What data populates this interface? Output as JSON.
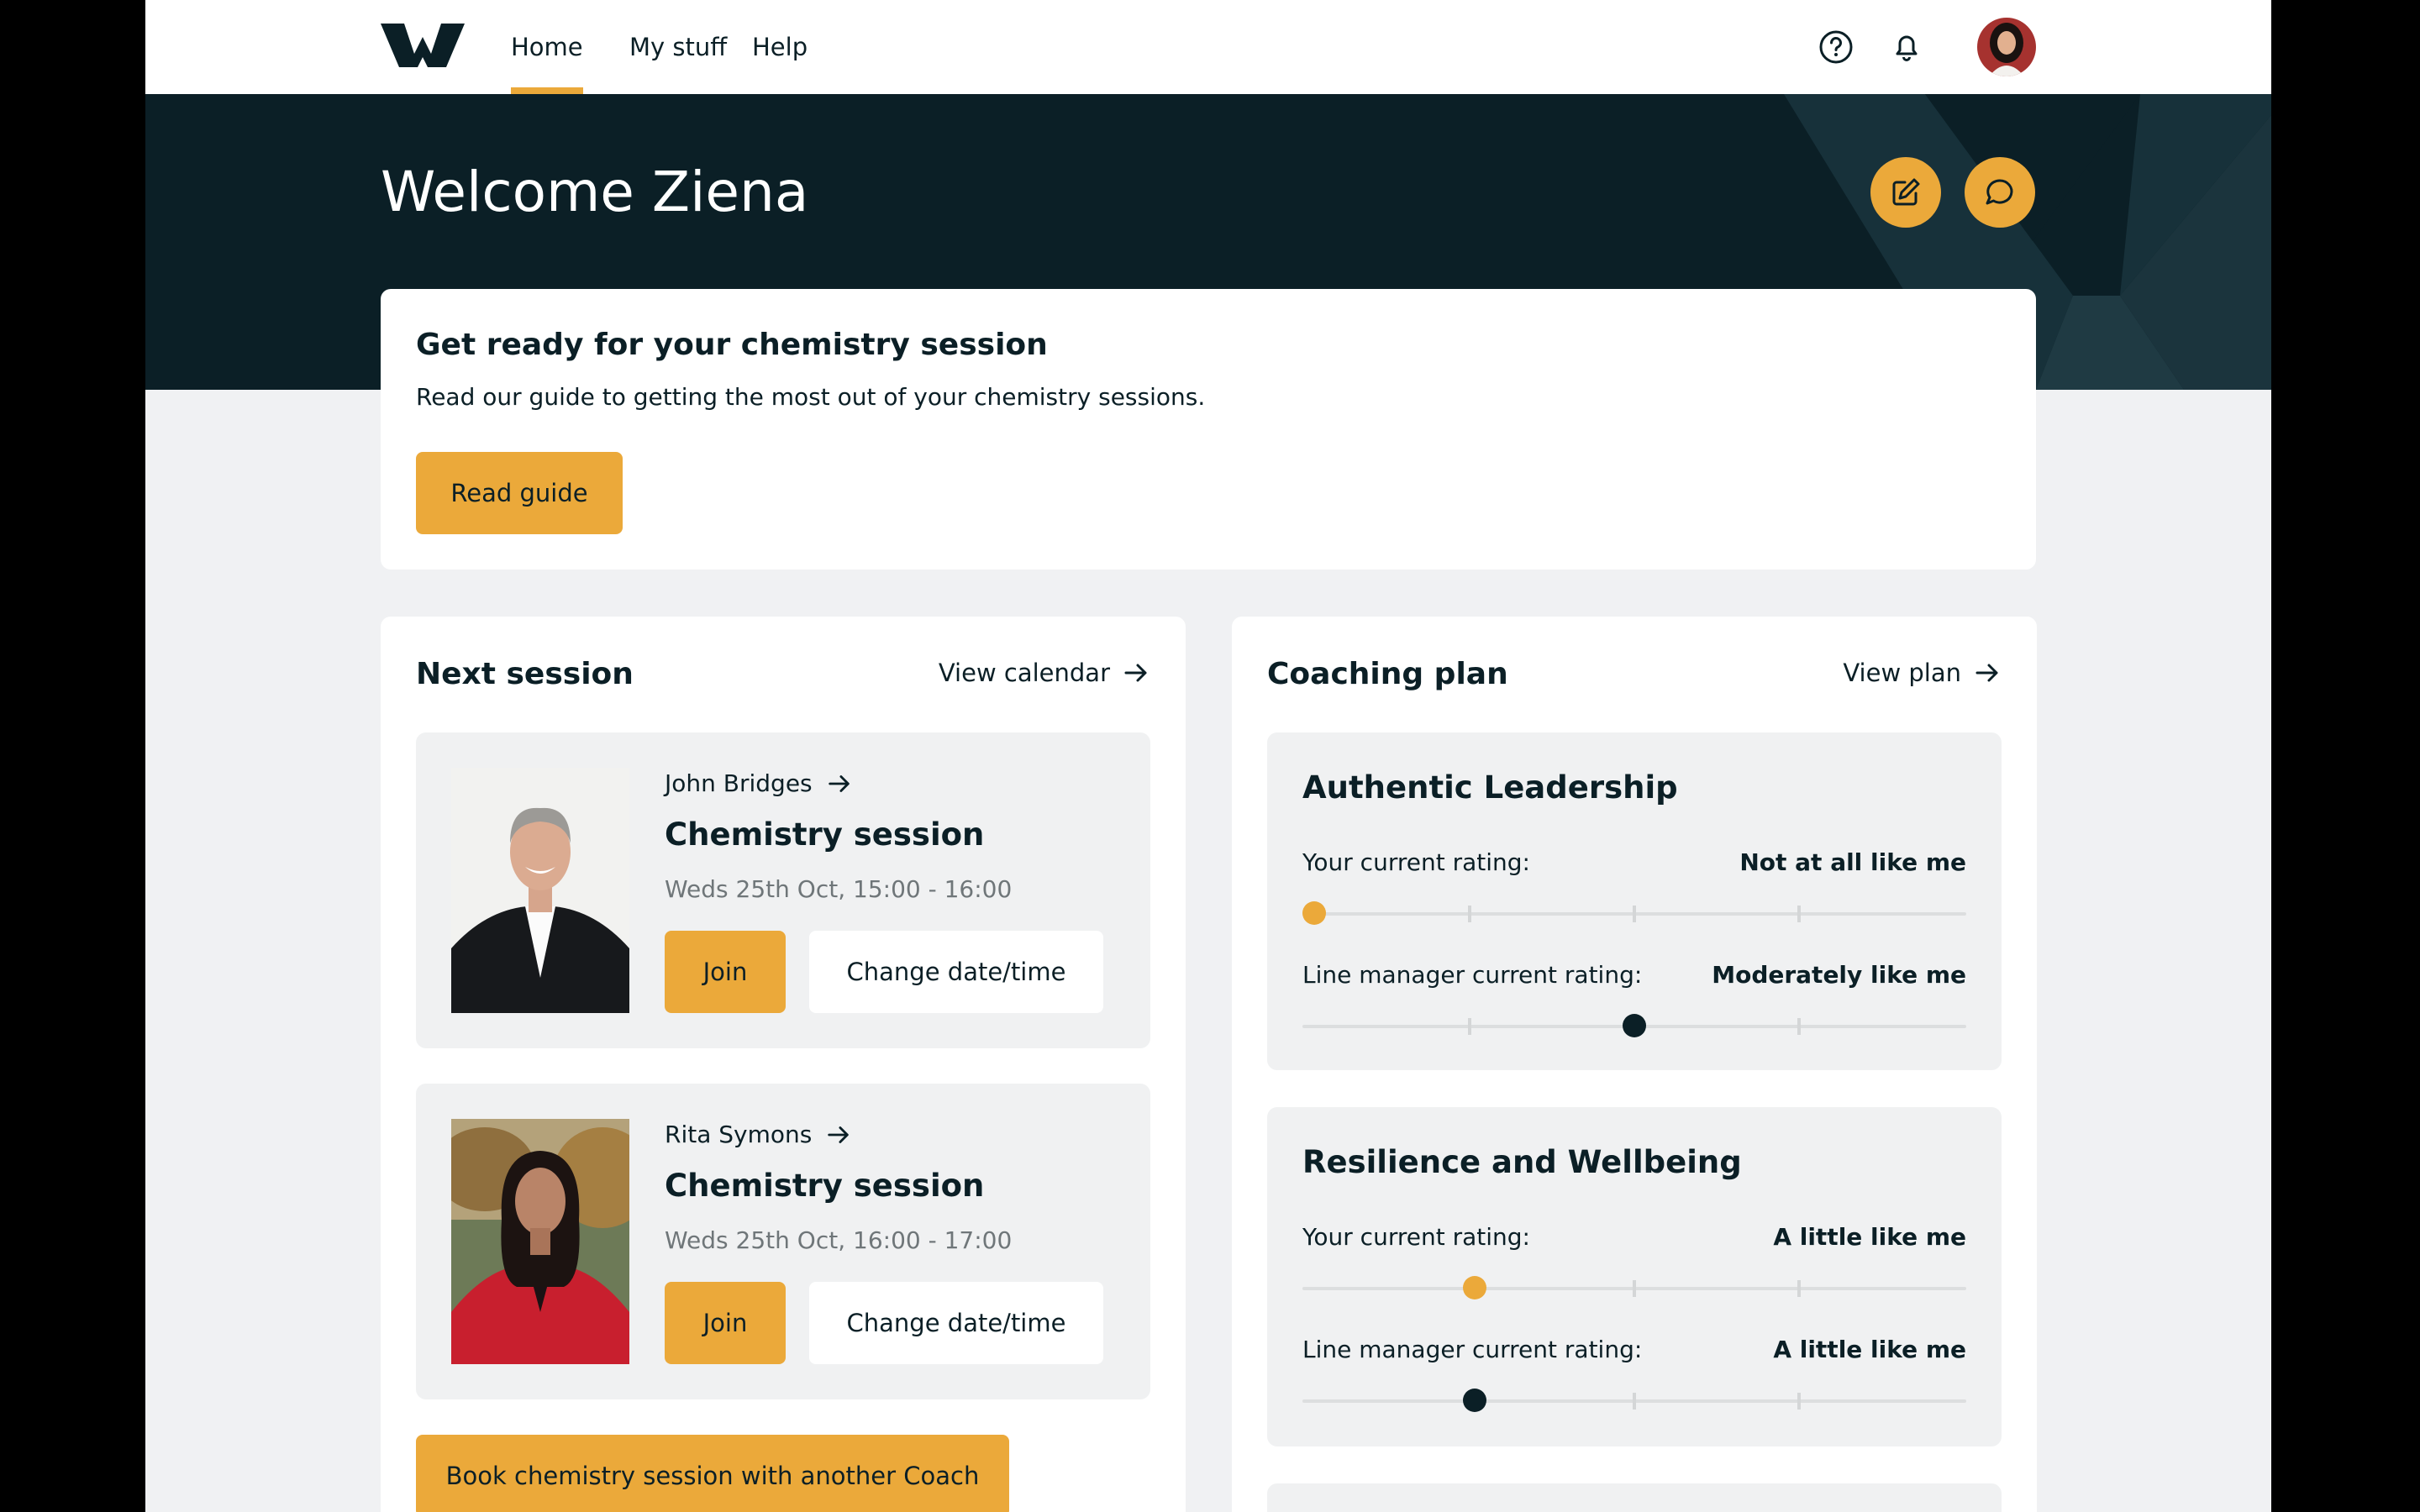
{
  "nav": {
    "tabs": [
      {
        "label": "Home",
        "active": true
      },
      {
        "label": "My stuff",
        "active": false
      },
      {
        "label": "Help",
        "active": false
      }
    ],
    "icons": [
      "help-circle-icon",
      "bell-icon"
    ]
  },
  "hero": {
    "welcome": "Welcome Ziena"
  },
  "guide": {
    "title": "Get ready for your chemistry session",
    "description": "Read our guide to getting the most out of your chemistry sessions.",
    "button": "Read guide"
  },
  "sessions": {
    "heading": "Next session",
    "link": "View calendar",
    "items": [
      {
        "coach": "John Bridges",
        "title": "Chemistry session",
        "time": "Weds 25th Oct, 15:00 - 16:00",
        "join": "Join",
        "change": "Change date/time"
      },
      {
        "coach": "Rita Symons",
        "title": "Chemistry session",
        "time": "Weds 25th Oct, 16:00 - 17:00",
        "join": "Join",
        "change": "Change date/time"
      }
    ],
    "book_button": "Book chemistry session with another Coach"
  },
  "plan": {
    "heading": "Coaching plan",
    "link": "View plan",
    "scale_steps": 5,
    "items": [
      {
        "title": "Authentic Leadership",
        "your_label": "Your current rating:",
        "your_value": "Not at all like me",
        "your_step": 0,
        "manager_label": "Line manager current rating:",
        "manager_value": "Moderately like me",
        "manager_step": 2
      },
      {
        "title": "Resilience and Wellbeing",
        "your_label": "Your current rating:",
        "your_value": "A little like me",
        "your_step": 1,
        "manager_label": "Line manager current rating:",
        "manager_value": "A little like me",
        "manager_step": 1
      }
    ]
  },
  "colors": {
    "accent": "#eba93a",
    "dark": "#0b1f26",
    "background": "#f0f1f3"
  }
}
